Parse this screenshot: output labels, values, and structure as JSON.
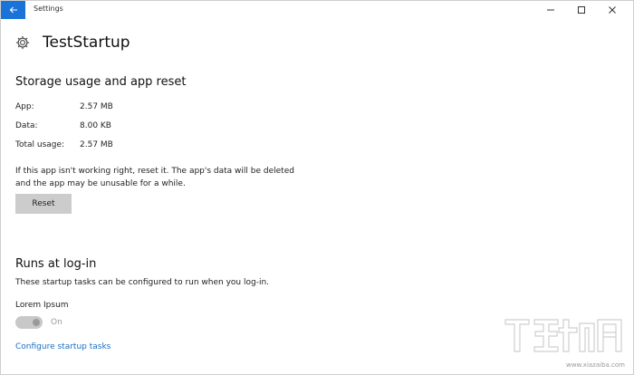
{
  "window": {
    "title": "Settings"
  },
  "page": {
    "title": "TestStartup"
  },
  "storage": {
    "heading": "Storage usage and app reset",
    "rows": [
      {
        "label": "App:",
        "value": "2.57 MB"
      },
      {
        "label": "Data:",
        "value": "8.00 KB"
      },
      {
        "label": "Total usage:",
        "value": "2.57 MB"
      }
    ],
    "description_line1": "If this app isn't working right, reset it. The app's data will be deleted",
    "description_line2": "and the app may be unusable for a while.",
    "reset_label": "Reset"
  },
  "runs": {
    "heading": "Runs at log-in",
    "description": "These startup tasks can be configured to run when you log-in.",
    "task_name": "Lorem Ipsum",
    "toggle_state": "On",
    "configure_link": "Configure startup tasks"
  },
  "watermark": {
    "site": "www.xiazaiba.com"
  },
  "colors": {
    "accent": "#1a73d9",
    "link": "#1a6fc4",
    "button_bg": "#cccccc",
    "toggle_bg": "#c8c8c8"
  }
}
